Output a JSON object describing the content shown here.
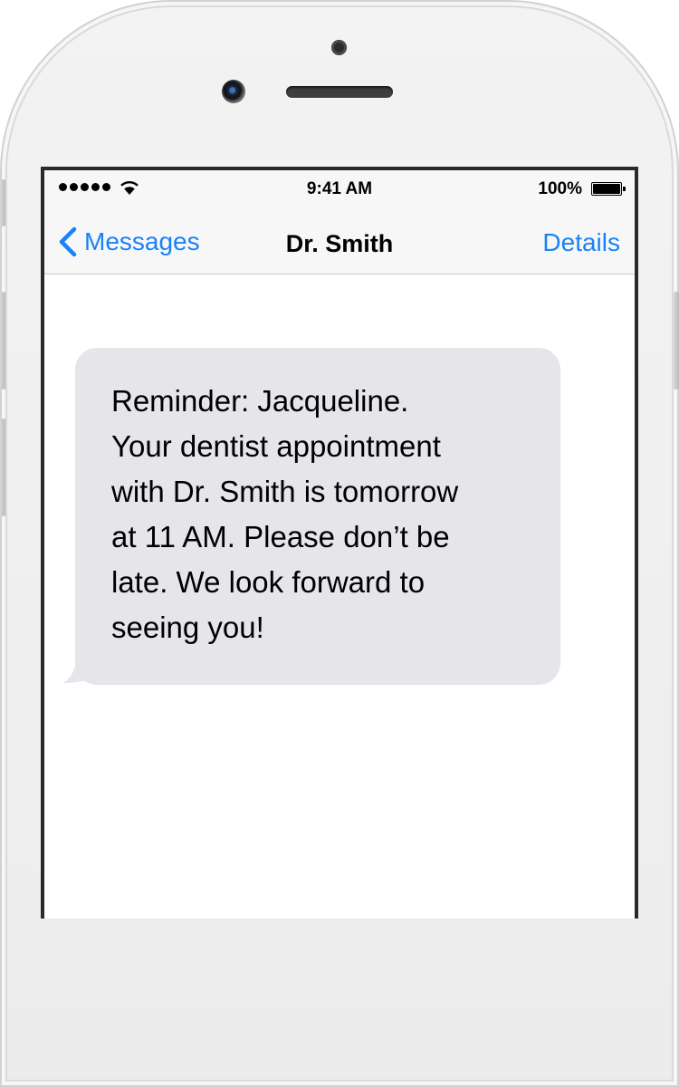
{
  "status_bar": {
    "time": "9:41 AM",
    "battery_percent": "100%",
    "signal_icon": "signal-dots-icon",
    "wifi_icon": "wifi-icon",
    "battery_icon": "battery-full-icon"
  },
  "nav": {
    "back_label": "Messages",
    "title": "Dr. Smith",
    "details_label": "Details",
    "accent_color": "#1a82f7"
  },
  "messages": [
    {
      "direction": "incoming",
      "text": "Reminder: Jacqueline.\nYour dentist appointment\nwith Dr. Smith is tomorrow\nat 11 AM. Please don’t be\nlate. We look forward to\nseeing you!",
      "bubble_color": "#e5e5ea"
    }
  ]
}
